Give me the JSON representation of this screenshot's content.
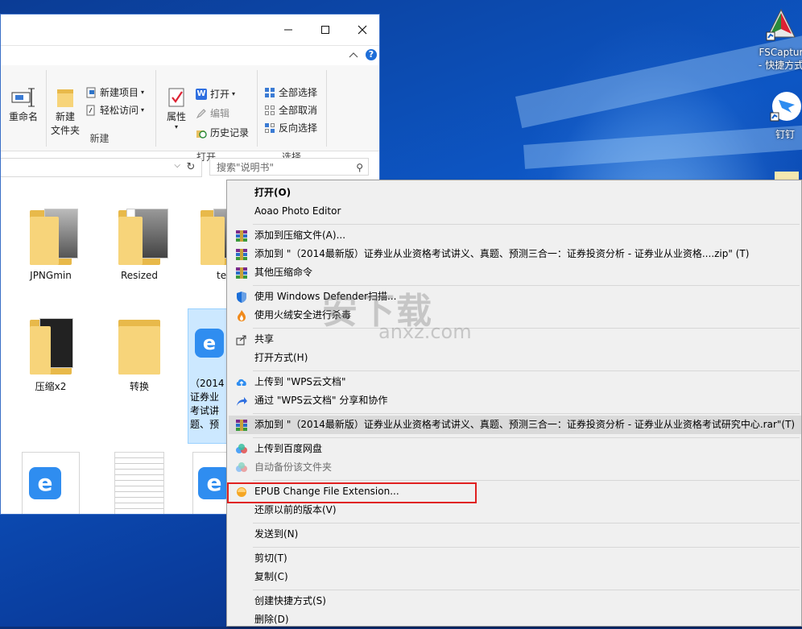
{
  "desktop": {
    "icons": [
      {
        "label1": "FSCaptur",
        "label2": "- 快捷方式"
      },
      {
        "label1": "钉钉",
        "label2": ""
      }
    ]
  },
  "ribbon": {
    "rename": "重命名",
    "new_folder": [
      "新建",
      "文件夹"
    ],
    "new_item": "新建项目",
    "easy_access": "轻松访问",
    "new_group": "新建",
    "properties": "属性",
    "open": "打开",
    "edit": "编辑",
    "history": "历史记录",
    "open_group": "打开",
    "select_all": "全部选择",
    "select_none": "全部取消",
    "invert_select": "反向选择",
    "select_group": "选择"
  },
  "search": {
    "placeholder": "搜索\"说明书\""
  },
  "files": [
    {
      "label": "JPNGmin"
    },
    {
      "label": "Resized"
    },
    {
      "label": "te"
    },
    {
      "label": "压缩x2"
    },
    {
      "label": "转换"
    },
    {
      "label_lines": [
        "（2014",
        "证券业",
        "考试讲",
        "题、预"
      ]
    }
  ],
  "watermark": {
    "main": "安下载",
    "sub": "anxz.com"
  },
  "context_menu": {
    "items": [
      {
        "label": "打开(O)",
        "bold": true
      },
      {
        "label": "Aoao Photo Editor"
      },
      {
        "label": "添加到压缩文件(A)..."
      },
      {
        "label": "添加到 \"（2014最新版）证券业从业资格考试讲义、真题、预测三合一：证券投资分析 - 证券业从业资格....zip\" (T)"
      },
      {
        "label": "其他压缩命令"
      },
      {
        "label": "使用 Windows Defender扫描..."
      },
      {
        "label": "使用火绒安全进行杀毒"
      },
      {
        "label": "共享"
      },
      {
        "label": "打开方式(H)"
      },
      {
        "label": "上传到 \"WPS云文档\""
      },
      {
        "label": "通过 \"WPS云文档\" 分享和协作"
      },
      {
        "label": "添加到 \"（2014最新版）证券业从业资格考试讲义、真题、预测三合一：证券投资分析 - 证券业从业资格考试研究中心.rar\"(T)"
      },
      {
        "label": "上传到百度网盘"
      },
      {
        "label": "自动备份该文件夹"
      },
      {
        "label": "EPUB   Change File Extension..."
      },
      {
        "label": "还原以前的版本(V)"
      },
      {
        "label": "发送到(N)"
      },
      {
        "label": "剪切(T)"
      },
      {
        "label": "复制(C)"
      },
      {
        "label": "创建快捷方式(S)"
      },
      {
        "label": "删除(D)"
      }
    ]
  }
}
